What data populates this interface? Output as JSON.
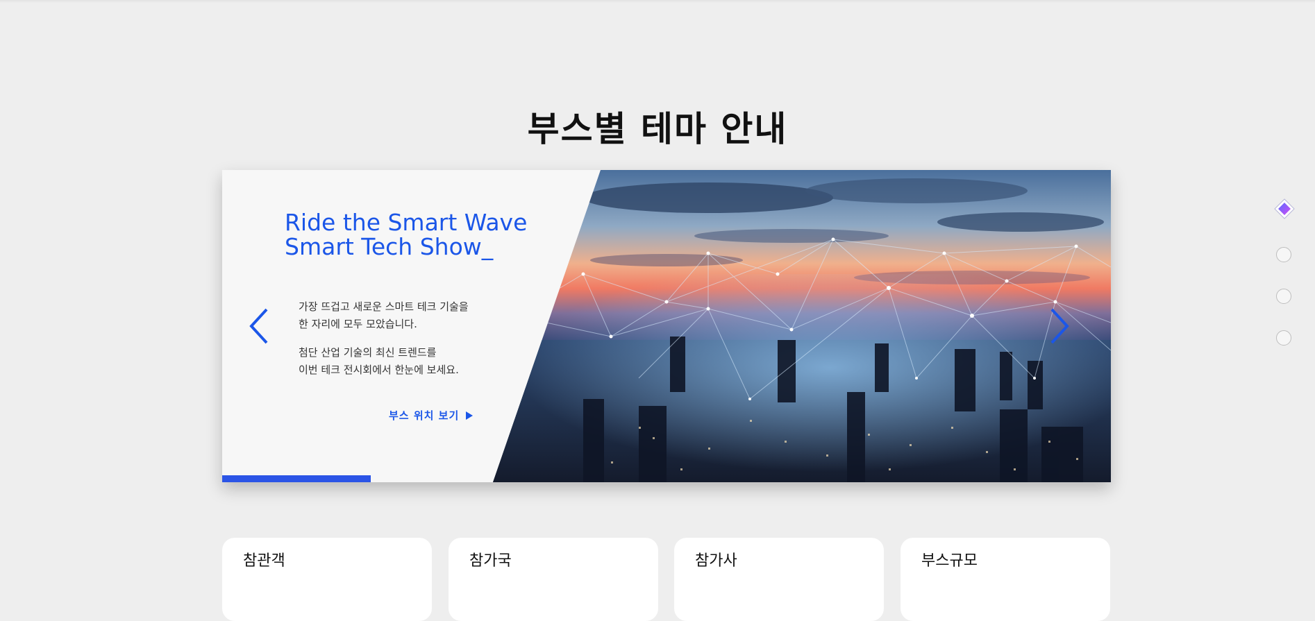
{
  "section": {
    "title": "부스별 테마 안내"
  },
  "slider": {
    "headline_line1": "Ride the Smart Wave",
    "headline_line2": "Smart Tech Show_",
    "paragraph1_line1": "가장 뜨겁고 새로운 스마트 테크 기술을",
    "paragraph1_line2": "한 자리에 모두 모았습니다.",
    "paragraph2_line1": "첨단 산업 기술의 최신 트렌드를",
    "paragraph2_line2": "이번 테크 전시회에서 한눈에 보세요.",
    "link_label": "부스 위치 보기",
    "image_subject": "city-skyline-network",
    "progress_fraction": 0.167,
    "accent_color": "#1b56e8"
  },
  "side_nav": {
    "active_index": 0,
    "count": 4
  },
  "stats": [
    {
      "label": "참관객"
    },
    {
      "label": "참가국"
    },
    {
      "label": "참가사"
    },
    {
      "label": "부스규모"
    }
  ]
}
